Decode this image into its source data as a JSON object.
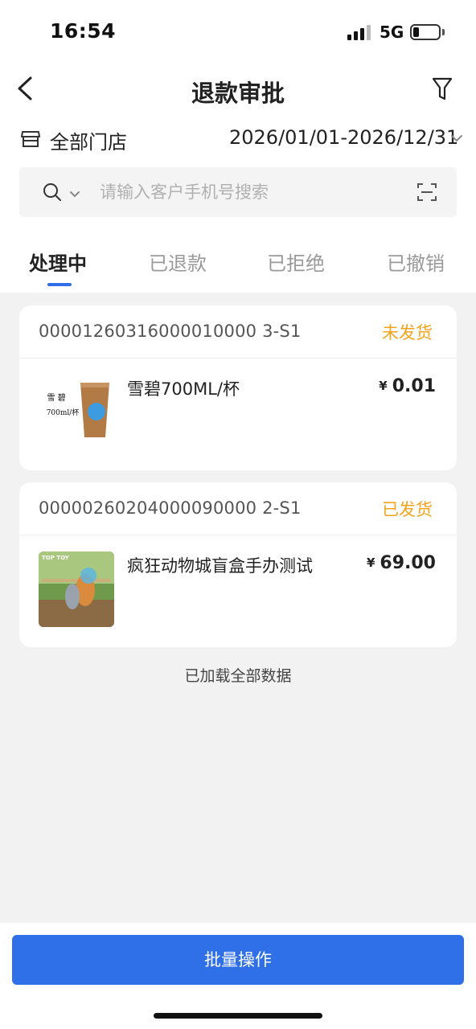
{
  "status_bar": {
    "time": "16:54",
    "network": "5G"
  },
  "nav": {
    "title": "退款审批",
    "back_icon": "back-arrow-icon",
    "filter_icon": "filter-icon"
  },
  "store": {
    "label": "全部门店",
    "icon": "store-icon"
  },
  "date_range": {
    "value": "2026/01/01-2026/12/31"
  },
  "search": {
    "placeholder": "请输入客户手机号搜索",
    "value": ""
  },
  "tabs": [
    {
      "label": "处理中",
      "active": true
    },
    {
      "label": "已退款",
      "active": false
    },
    {
      "label": "已拒绝",
      "active": false
    },
    {
      "label": "已撤销",
      "active": false
    }
  ],
  "orders": [
    {
      "order_no": "00001260316000010000 3-S1",
      "status": "未发货",
      "product": {
        "name": "雪碧700ML/杯",
        "currency": "¥",
        "price": "0.01",
        "thumb_text_1": "雪 碧",
        "thumb_text_2": "700ml/杯"
      }
    },
    {
      "order_no": "00000260204000090000 2-S1",
      "status": "已发货",
      "product": {
        "name": "疯狂动物城盲盒手办测试",
        "currency": "¥",
        "price": "69.00",
        "thumb_text_1": "TOP TOY"
      }
    }
  ],
  "loaded_text": "已加载全部数据",
  "batch_button": "批量操作",
  "colors": {
    "accent": "#2f6fe8",
    "status_orange": "#f4a31c",
    "background": "#f2f2f2"
  }
}
